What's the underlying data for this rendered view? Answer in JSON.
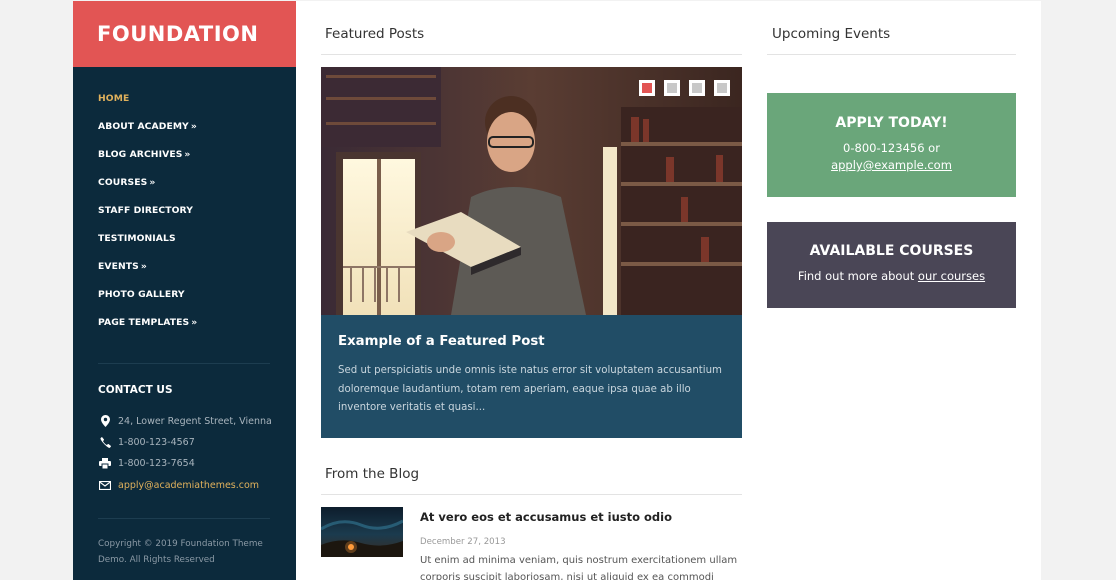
{
  "site": {
    "logo": "FOUNDATION"
  },
  "nav": [
    {
      "label": "HOME",
      "has_submenu": false
    },
    {
      "label": "ABOUT ACADEMY",
      "has_submenu": true
    },
    {
      "label": "BLOG ARCHIVES",
      "has_submenu": true
    },
    {
      "label": "COURSES",
      "has_submenu": true
    },
    {
      "label": "STAFF DIRECTORY",
      "has_submenu": false
    },
    {
      "label": "TESTIMONIALS",
      "has_submenu": false
    },
    {
      "label": "EVENTS",
      "has_submenu": true
    },
    {
      "label": "PHOTO GALLERY",
      "has_submenu": false
    },
    {
      "label": "PAGE TEMPLATES",
      "has_submenu": true
    }
  ],
  "submenu_arrow": "»",
  "contact": {
    "title": "CONTACT US",
    "address": "24, Lower Regent Street, Vienna",
    "phone": "1-800-123-4567",
    "fax": "1-800-123-7654",
    "email": "apply@academiathemes.com"
  },
  "copyright": "Copyright © 2019 Foundation Theme Demo. All Rights Reserved",
  "featured": {
    "section_title": "Featured Posts",
    "post_title": "Example of a Featured Post",
    "excerpt": "Sed ut perspiciatis unde omnis iste natus error sit voluptatem accusantium doloremque laudantium, totam rem aperiam, eaque ipsa quae ab illo inventore veritatis et quasi...",
    "slides_count": 4,
    "active_slide": 1
  },
  "blog": {
    "section_title": "From the Blog",
    "post_title": "At vero eos et accusamus et iusto odio",
    "date": "December 27, 2013",
    "excerpt_line1": "Ut enim ad minima veniam, quis nostrum exercitationem ullam",
    "excerpt_line2": "corporis suscipit laboriosam, nisi ut aliquid ex ea commodi"
  },
  "events": {
    "section_title": "Upcoming Events",
    "apply": {
      "heading": "APPLY TODAY!",
      "phone_line": "0-800-123456 or",
      "email_link": "apply@example.com"
    },
    "courses": {
      "heading": "AVAILABLE COURSES",
      "text": "Find out more about",
      "link": "our courses"
    }
  },
  "colors": {
    "brand": "#e25554",
    "sidebar": "#0c2a3c",
    "accent": "#e0b15c",
    "caption_bg": "#214d66",
    "apply_bg": "#6aa67a",
    "courses_bg": "#4a4656"
  },
  "icons": [
    "map-marker-icon",
    "phone-icon",
    "fax-icon",
    "envelope-icon"
  ]
}
